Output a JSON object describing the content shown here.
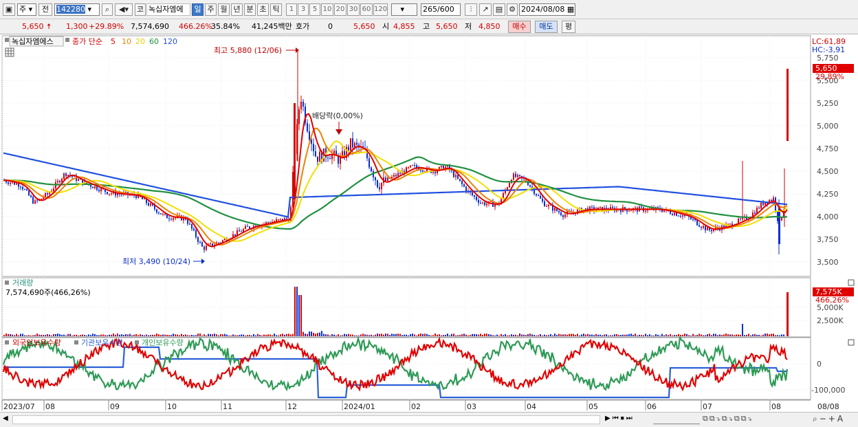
{
  "toolbar": {
    "market_type": "주",
    "prev_label": "전",
    "code": "142280",
    "market_badge": "코",
    "stock_name": "녹십자엠에",
    "periods": [
      "일",
      "주",
      "월",
      "년",
      "분",
      "초",
      "틱"
    ],
    "selected_period": "일",
    "intervals": [
      "1",
      "3",
      "5",
      "10",
      "20",
      "30",
      "60",
      "120"
    ],
    "count_value": "265",
    "count_total": "/600",
    "date": "2024/08/08"
  },
  "quote": {
    "price": "5,650",
    "change": "1,300",
    "change_pct": "+29.89%",
    "volume": "7,574,690",
    "volume_ratio": "466.26%",
    "turnover": "35.84%",
    "amount": "41,245백만",
    "hoga_label": "호가",
    "hoga_value": "0",
    "ask_price": "5,650",
    "open_label": "시",
    "open": "4,855",
    "high_label": "고",
    "high": "5,650",
    "low_label": "저",
    "low": "4,850",
    "buy_label": "매수",
    "sell_label": "매도",
    "avg_label": "평"
  },
  "price_panel": {
    "stock_tag": "녹십자엠에스",
    "ma_title": "종가 단순",
    "ma_periods": [
      "5",
      "10",
      "20",
      "60",
      "120"
    ],
    "high_annotation": "최고 5,880 (12/06)",
    "low_annotation": "최저 3,490 (10/24)",
    "dividend_annotation": "배당락(0,00%)",
    "lc_label": "LC:61,89",
    "hc_label": "HC:-3,91",
    "current_price_tag": "5,650",
    "current_pct_tag": "29,89%",
    "y_ticks": [
      "5,750",
      "5,500",
      "5,250",
      "5,000",
      "4,750",
      "4,500",
      "4,250",
      "4,000",
      "3,750",
      "3,500"
    ]
  },
  "volume_panel": {
    "title": "거래량",
    "value_label": "7,574,690주(466,26%)",
    "current_tag": "7,575K",
    "pct_tag": "466,26%",
    "y_ticks": [
      "5,000K",
      "2,500K"
    ]
  },
  "holdings_panel": {
    "legend": [
      "외국인보유수량",
      "기관보유수량",
      "개인보유수량"
    ],
    "y_ticks": [
      "0",
      "-100,000"
    ]
  },
  "x_axis": [
    "2023/07",
    "08",
    "09",
    "10",
    "11",
    "12",
    "2024/01",
    "02",
    "03",
    "04",
    "05",
    "06",
    "07",
    "08",
    "08/08"
  ],
  "colors": {
    "up": "#d40000",
    "down": "#0a2fc8",
    "ma5": "#e00000",
    "ma10": "#f08000",
    "ma20": "#f0e000",
    "ma60": "#209040",
    "ma120": "#2050e0",
    "foreign": "#e00000",
    "institution": "#2a60d8",
    "individual": "#2e9a55"
  }
}
